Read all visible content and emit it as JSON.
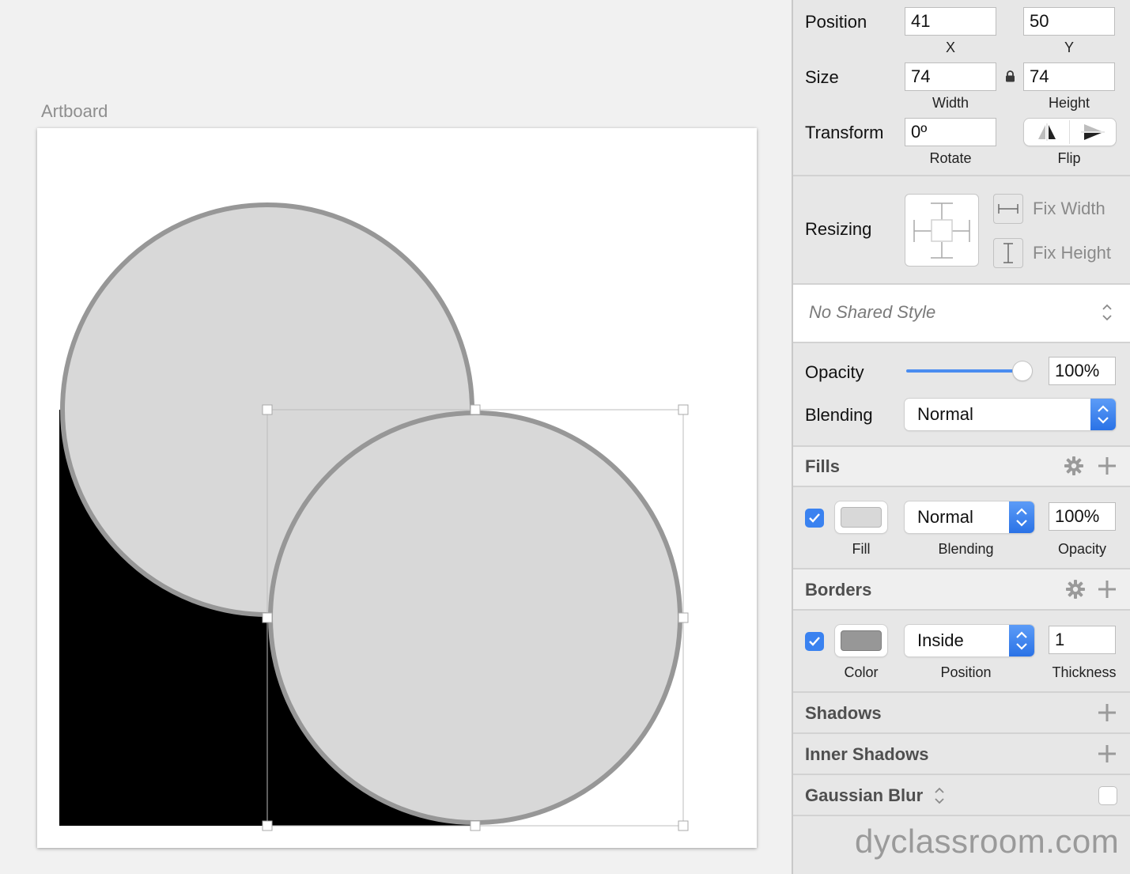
{
  "canvas": {
    "artboard_label": "Artboard",
    "shapes": {
      "fill_color": "#d8d8d8",
      "border_color": "#979797",
      "background_block_color": "#000000"
    }
  },
  "inspector": {
    "position": {
      "label": "Position",
      "x": "41",
      "y": "50",
      "x_caption": "X",
      "y_caption": "Y"
    },
    "size": {
      "label": "Size",
      "width": "74",
      "height": "74",
      "width_caption": "Width",
      "height_caption": "Height",
      "lock_icon": "lock-icon"
    },
    "transform": {
      "label": "Transform",
      "rotate": "0º",
      "rotate_caption": "Rotate",
      "flip_caption": "Flip"
    },
    "resizing": {
      "label": "Resizing",
      "fix_width": "Fix Width",
      "fix_height": "Fix Height"
    },
    "shared_style": {
      "value": "No Shared Style"
    },
    "opacity": {
      "label": "Opacity",
      "value": "100%",
      "slider_percent": 100
    },
    "blending": {
      "label": "Blending",
      "value": "Normal"
    },
    "fills": {
      "title": "Fills",
      "items": [
        {
          "enabled": true,
          "color": "#d8d8d8",
          "blending": "Normal",
          "opacity": "100%"
        }
      ],
      "captions": {
        "fill": "Fill",
        "blending": "Blending",
        "opacity": "Opacity"
      }
    },
    "borders": {
      "title": "Borders",
      "items": [
        {
          "enabled": true,
          "color": "#979797",
          "position": "Inside",
          "thickness": "1"
        }
      ],
      "captions": {
        "color": "Color",
        "position": "Position",
        "thickness": "Thickness"
      }
    },
    "shadows": {
      "title": "Shadows"
    },
    "inner_shadows": {
      "title": "Inner Shadows"
    },
    "gaussian_blur": {
      "title": "Gaussian Blur",
      "enabled": false
    },
    "accent_color": "#3a82f0"
  },
  "watermark": "dyclassroom.com"
}
